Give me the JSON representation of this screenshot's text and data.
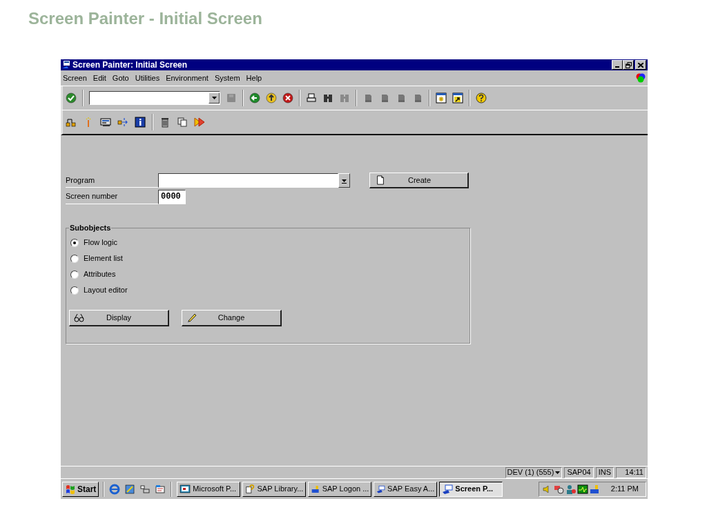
{
  "slide_title": "Screen Painter - Initial Screen",
  "window": {
    "title": "Screen Painter: Initial Screen"
  },
  "menu": [
    "Screen",
    "Edit",
    "Goto",
    "Utilities",
    "Environment",
    "System",
    "Help"
  ],
  "form": {
    "program_label": "Program",
    "screen_number_label": "Screen number",
    "screen_number": "0000",
    "create_button": "Create"
  },
  "subobjects": {
    "title": "Subobjects",
    "options": [
      {
        "label": "Flow logic",
        "selected": true
      },
      {
        "label": "Element list",
        "selected": false
      },
      {
        "label": "Attributes",
        "selected": false
      },
      {
        "label": "Layout editor",
        "selected": false
      }
    ],
    "buttons": [
      {
        "label": "Display",
        "kind": "display"
      },
      {
        "label": "Change",
        "kind": "change"
      }
    ]
  },
  "status_bar": {
    "system": "DEV (1) (555)",
    "server": "SAP04",
    "mode": "INS",
    "time": "14:11"
  },
  "taskbar": {
    "start": "Start",
    "tasks": [
      {
        "label": "Microsoft P...",
        "kind": "presentation",
        "selected": false
      },
      {
        "label": "SAP Library...",
        "kind": "help",
        "selected": false
      },
      {
        "label": "SAP Logon ...",
        "kind": "logon",
        "selected": false
      },
      {
        "label": "SAP Easy A...",
        "kind": "sap",
        "selected": false
      },
      {
        "label": "Screen P...",
        "kind": "sap",
        "selected": true
      }
    ],
    "clock": "2:11 PM"
  }
}
